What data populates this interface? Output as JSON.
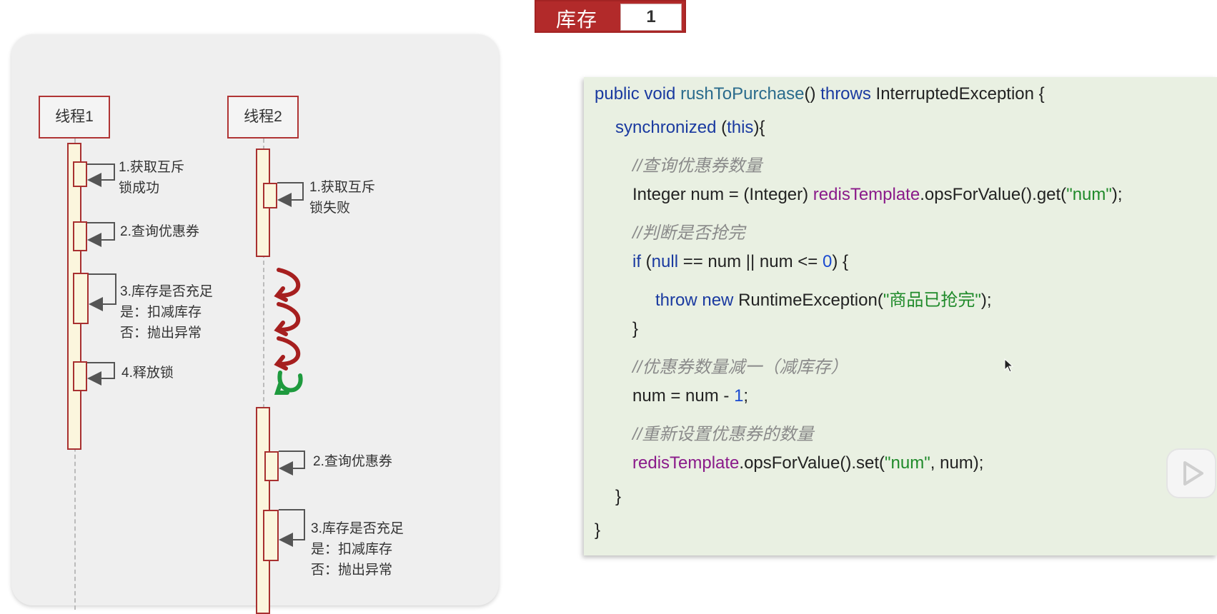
{
  "stock": {
    "label": "库存",
    "value": "1"
  },
  "diagram": {
    "thread1": {
      "name": "线程1",
      "steps": [
        [
          "1.获取互斥",
          "锁成功"
        ],
        [
          "2.查询优惠券"
        ],
        [
          "3.库存是否充足",
          "是：扣减库存",
          "否：抛出异常"
        ],
        [
          "4.释放锁"
        ]
      ]
    },
    "thread2": {
      "name": "线程2",
      "steps": [
        [
          "1.获取互斥",
          "锁失败"
        ],
        [
          "2.查询优惠券"
        ],
        [
          "3.库存是否充足",
          "是：扣减库存",
          "否：抛出异常"
        ]
      ]
    },
    "retry_arrows": {
      "color_fail": "#a61f1f",
      "color_success": "#1e9a3e",
      "fail_count": 3,
      "success_count": 1
    }
  },
  "code": {
    "lines": [
      {
        "indent": 0,
        "tokens": [
          {
            "t": "public void ",
            "c": "kw"
          },
          {
            "t": "rushToPurchase",
            "c": "fn"
          },
          {
            "t": "() ",
            "c": ""
          },
          {
            "t": "throws ",
            "c": "kw"
          },
          {
            "t": "InterruptedException {",
            "c": ""
          }
        ]
      },
      {
        "indent": 1,
        "tokens": [
          {
            "t": "synchronized ",
            "c": "kw"
          },
          {
            "t": "(",
            "c": ""
          },
          {
            "t": "this",
            "c": "kw"
          },
          {
            "t": "){",
            "c": ""
          }
        ]
      },
      {
        "indent": 2,
        "tokens": [
          {
            "t": "//查询优惠券数量",
            "c": "cm"
          }
        ]
      },
      {
        "indent": 2,
        "tokens": [
          {
            "t": "Integer num = (Integer) ",
            "c": ""
          },
          {
            "t": "redisTemplate",
            "c": "field"
          },
          {
            "t": ".opsForValue().get(",
            "c": ""
          },
          {
            "t": "\"num\"",
            "c": "str"
          },
          {
            "t": ");",
            "c": ""
          }
        ]
      },
      {
        "indent": 2,
        "tokens": [
          {
            "t": "//判断是否抢完",
            "c": "cm"
          }
        ]
      },
      {
        "indent": 2,
        "tokens": [
          {
            "t": "if ",
            "c": "kw"
          },
          {
            "t": "(",
            "c": ""
          },
          {
            "t": "null",
            "c": "kw"
          },
          {
            "t": " == num || num <= ",
            "c": ""
          },
          {
            "t": "0",
            "c": "num"
          },
          {
            "t": ") {",
            "c": ""
          }
        ]
      },
      {
        "indent": 3,
        "tokens": [
          {
            "t": "throw new ",
            "c": "kw"
          },
          {
            "t": "RuntimeException(",
            "c": ""
          },
          {
            "t": "\"商品已抢完\"",
            "c": "str"
          },
          {
            "t": ");",
            "c": ""
          }
        ]
      },
      {
        "indent": 2,
        "tokens": [
          {
            "t": "}",
            "c": ""
          }
        ]
      },
      {
        "indent": 2,
        "tokens": [
          {
            "t": "//优惠券数量减一（减库存）",
            "c": "cm"
          }
        ]
      },
      {
        "indent": 2,
        "tokens": [
          {
            "t": "num = num - ",
            "c": ""
          },
          {
            "t": "1",
            "c": "num"
          },
          {
            "t": ";",
            "c": ""
          }
        ]
      },
      {
        "indent": 2,
        "tokens": [
          {
            "t": "//重新设置优惠券的数量",
            "c": "cm"
          }
        ]
      },
      {
        "indent": 2,
        "tokens": [
          {
            "t": "redisTemplate",
            "c": "field"
          },
          {
            "t": ".opsForValue().set(",
            "c": ""
          },
          {
            "t": "\"num\"",
            "c": "str"
          },
          {
            "t": ", num);",
            "c": ""
          }
        ]
      },
      {
        "indent": 1,
        "tokens": [
          {
            "t": "}",
            "c": ""
          }
        ]
      },
      {
        "indent": 0,
        "tokens": [
          {
            "t": "}",
            "c": ""
          }
        ]
      }
    ]
  },
  "colors": {
    "accent_red": "#b22a2a",
    "code_bg": "#e9f0e2"
  },
  "icons": [
    "play-icon",
    "mouse-cursor-icon"
  ]
}
